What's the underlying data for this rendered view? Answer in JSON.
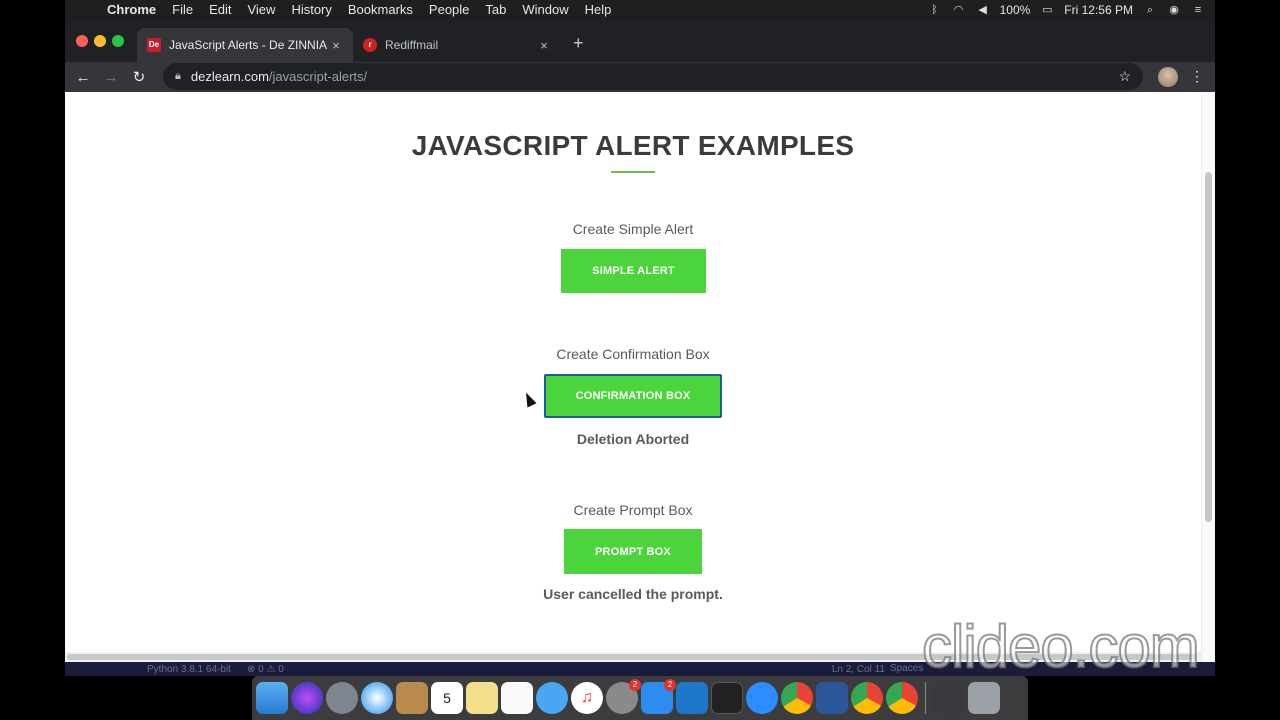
{
  "menubar": {
    "app": "Chrome",
    "items": [
      "File",
      "Edit",
      "View",
      "History",
      "Bookmarks",
      "People",
      "Tab",
      "Window",
      "Help"
    ],
    "battery": "100%",
    "clock": "Fri 12:56 PM"
  },
  "browser": {
    "tabs": [
      {
        "title": "JavaScript Alerts - De ZINNIA",
        "favicon": "De",
        "favicon_color": "#c8202b",
        "close": "×"
      },
      {
        "title": "Rediffmail",
        "favicon": "r",
        "favicon_color": "#d12222",
        "close": "×"
      }
    ],
    "new_tab": "+",
    "url_host": "dezlearn.com",
    "url_path": "/javascript-alerts/"
  },
  "page": {
    "title": "JAVASCRIPT ALERT EXAMPLES",
    "accent": "#4cd43d",
    "sections": [
      {
        "label": "Create Simple Alert",
        "button": "SIMPLE ALERT",
        "result": ""
      },
      {
        "label": "Create Confirmation Box",
        "button": "CONFIRMATION BOX",
        "result": "Deletion Aborted"
      },
      {
        "label": "Create Prompt Box",
        "button": "PROMPT BOX",
        "result": "User cancelled the prompt."
      }
    ]
  },
  "vscode_status": {
    "interpreter": "Python 3.8.1 64-bit",
    "problems": "⊗ 0 ⚠ 0",
    "cursor_pos": "Ln 2, Col 11",
    "spaces": "Spaces"
  },
  "dock": {
    "apps": [
      "finder-icon",
      "siri-icon",
      "launchpad-icon",
      "safari-icon",
      "notes-icon",
      "calendar-icon",
      "stickies-icon",
      "reminders-icon",
      "messages-icon",
      "music-icon",
      "system-preferences-icon",
      "app-store-icon",
      "vscode-icon",
      "terminal-icon",
      "zoom-icon",
      "chrome-icon",
      "word-icon",
      "chrome-icon-2",
      "chrome-icon-3",
      "downloads-icon",
      "trash-icon"
    ],
    "calendar_day": "5",
    "badge_sysprefs": "2",
    "badge_appstore": "2"
  },
  "watermark": "clideo.com"
}
